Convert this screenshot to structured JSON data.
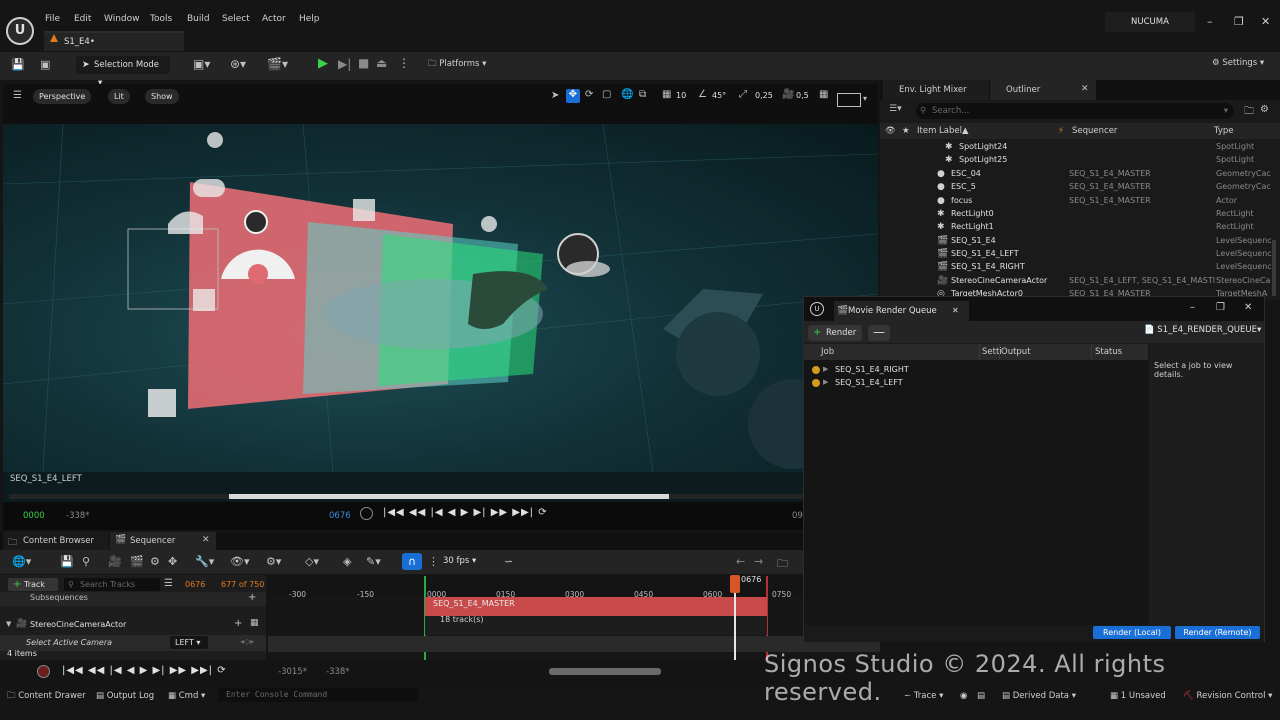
{
  "menu": [
    "File",
    "Edit",
    "Window",
    "Tools",
    "Build",
    "Select",
    "Actor",
    "Help"
  ],
  "level_tab": "S1_E4•",
  "project_name": "NUCUMA",
  "toolbar": {
    "selection_mode": "Selection Mode",
    "platforms": "Platforms",
    "settings": "Settings"
  },
  "viewport": {
    "perspective": "Perspective",
    "lit": "Lit",
    "show": "Show",
    "grid_size": "10",
    "rotation_snap": "45°",
    "scale_snap": "0,25",
    "camera_speed": "0,5",
    "camera_label": "SEQ_S1_E4_LEFT",
    "tc_start": "0000",
    "tc_in": "-338*",
    "tc_current": "0676",
    "tc_end": "09"
  },
  "outliner": {
    "tabs": [
      "Env. Light Mixer",
      "Outliner"
    ],
    "search_placeholder": "Search...",
    "col_label": "Item Label",
    "col_sequencer": "Sequencer",
    "col_type": "Type",
    "rows": [
      {
        "label": "SpotLight24",
        "seq": "",
        "type": "SpotLight"
      },
      {
        "label": "SpotLight25",
        "seq": "",
        "type": "SpotLight"
      },
      {
        "label": "ESC_04",
        "seq": "SEQ_S1_E4_MASTER",
        "type": "GeometryCac"
      },
      {
        "label": "ESC_5",
        "seq": "SEQ_S1_E4_MASTER",
        "type": "GeometryCac"
      },
      {
        "label": "focus",
        "seq": "SEQ_S1_E4_MASTER",
        "type": "Actor"
      },
      {
        "label": "RectLight0",
        "seq": "",
        "type": "RectLight"
      },
      {
        "label": "RectLight1",
        "seq": "",
        "type": "RectLight"
      },
      {
        "label": "SEQ_S1_E4",
        "seq": "",
        "type": "LevelSequenc"
      },
      {
        "label": "SEQ_S1_E4_LEFT",
        "seq": "",
        "type": "LevelSequenc"
      },
      {
        "label": "SEQ_S1_E4_RIGHT",
        "seq": "",
        "type": "LevelSequenc"
      },
      {
        "label": "StereoCineCameraActor",
        "seq": "SEQ_S1_E4_LEFT, SEQ_S1_E4_MASTI",
        "type": "StereoCineCa"
      },
      {
        "label": "TargetMeshActor0",
        "seq": "SEQ_S1_E4_MASTER",
        "type": "TargetMeshA"
      }
    ]
  },
  "mrq": {
    "title": "Movie Render Queue",
    "render_button": "Render",
    "queue_name": "S1_E4_RENDER_QUEUE",
    "col_job": "Job",
    "col_settings": "Setti",
    "col_output": "Output",
    "col_status": "Status",
    "jobs": [
      "SEQ_S1_E4_RIGHT",
      "SEQ_S1_E4_LEFT"
    ],
    "detail_hint": "Select a job to view details.",
    "render_local": "Render (Local)",
    "render_remote": "Render (Remote)"
  },
  "bottom_tabs": [
    "Content Browser",
    "Sequencer"
  ],
  "sequencer": {
    "fps": "30 fps",
    "add_track": "Track",
    "search_tracks": "Search Tracks",
    "current_frame": "0676",
    "frame_count": "677 of 750",
    "subsequences": "Subsequences",
    "camera_actor": "StereoCineCameraActor",
    "select_camera": "Select Active Camera",
    "camera_choice": "LEFT",
    "item_count": "4 items",
    "ticks": [
      "-300",
      "-150",
      "0000",
      "0150",
      "0300",
      "0450",
      "0600",
      "0750"
    ],
    "playhead_label": "0676",
    "master_section": "SEQ_S1_E4_MASTER",
    "track_count": "18 track(s)",
    "bottom_in": "-3015*",
    "bottom_out": "-338*"
  },
  "statusbar": {
    "content_drawer": "Content Drawer",
    "output_log": "Output Log",
    "cmd": "Cmd",
    "console_placeholder": "Enter Console Command",
    "trace": "Trace",
    "derived_data": "Derived Data",
    "unsaved": "1 Unsaved",
    "revision_control": "Revision Control"
  },
  "watermark": "Signos Studio © 2024. All rights reserved.",
  "colors": {
    "accent_blue": "#1a6fd6",
    "play_green": "#3bd14a",
    "master_red": "#c94a4a",
    "job_dot": "#d69a1a"
  }
}
